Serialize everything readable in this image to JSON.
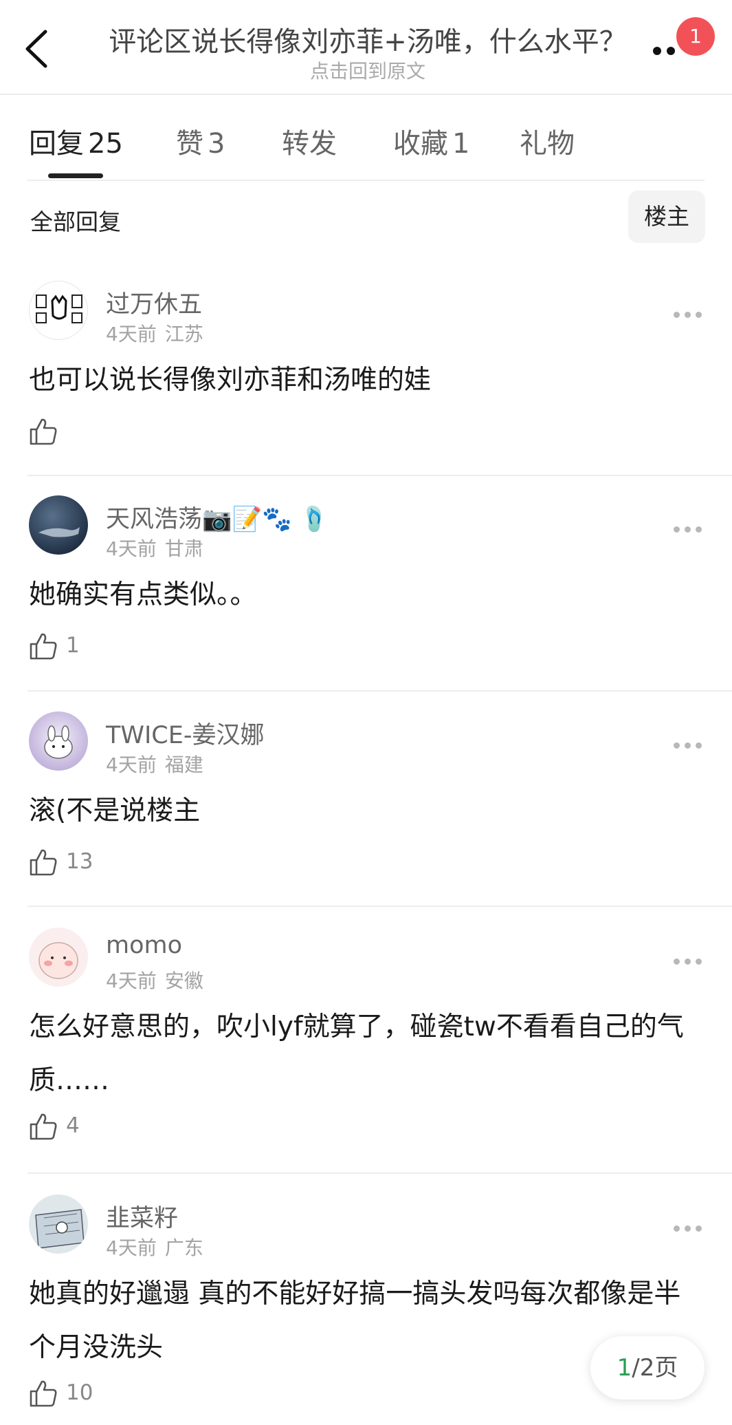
{
  "header": {
    "title": "评论区说长得像刘亦菲+汤唯，什么水平？",
    "subtitle": "点击回到原文",
    "badge_count": "1",
    "icons": {
      "back": "chevron-left-icon",
      "more": "more-dots-icon"
    }
  },
  "tabs": [
    {
      "label": "回复",
      "count": "25",
      "active": true
    },
    {
      "label": "赞",
      "count": "3",
      "active": false
    },
    {
      "label": "转发",
      "count": "",
      "active": false
    },
    {
      "label": "收藏",
      "count": "1",
      "active": false
    },
    {
      "label": "礼物",
      "count": "",
      "active": false
    }
  ],
  "filter": {
    "label": "全部回复",
    "owner_button": "楼主"
  },
  "comments": [
    {
      "username": "过万休五",
      "time": "4天前",
      "location": "江苏",
      "text": "也可以说长得像刘亦菲和汤唯的娃",
      "likes": ""
    },
    {
      "username": "天风浩荡📷📝🐾 🩴",
      "time": "4天前",
      "location": "甘肃",
      "text": "她确实有点类似。。",
      "likes": "1"
    },
    {
      "username": "TWICE-姜汉娜",
      "time": "4天前",
      "location": "福建",
      "text": "滚(不是说楼主",
      "likes": "13"
    },
    {
      "username": "momo",
      "time": "4天前",
      "location": "安徽",
      "text": "怎么好意思的，吹小lyf就算了，碰瓷tw不看看自己的气质……",
      "likes": "4"
    },
    {
      "username": "韭菜籽",
      "time": "4天前",
      "location": "广东",
      "text": "她真的好邋遢 真的不能好好搞一搞头发吗每次都像是半个月没洗头",
      "likes": "10"
    }
  ],
  "pagination": {
    "current": "1",
    "total_label": "/2页"
  },
  "colors": {
    "badge": "#f25257",
    "page_current": "#2a9d55",
    "meta_text": "#a3a3a3"
  }
}
